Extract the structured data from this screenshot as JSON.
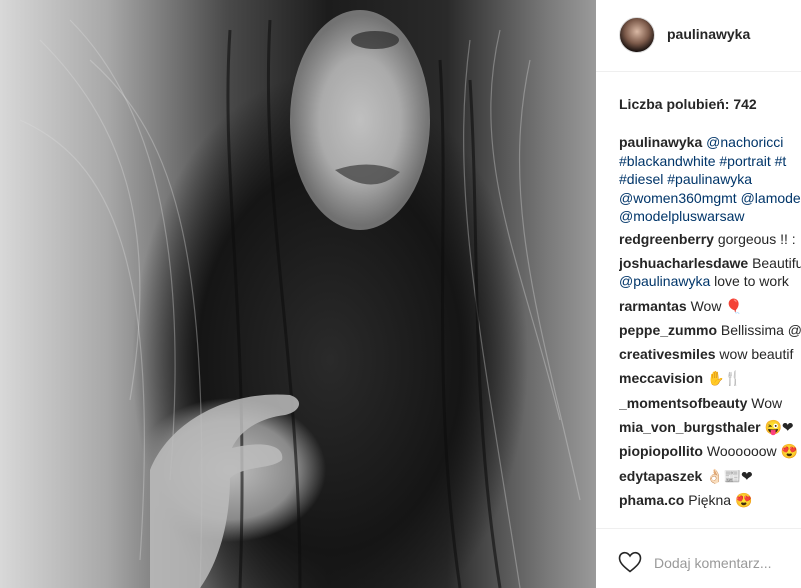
{
  "post": {
    "username": "paulinawyka",
    "likes_text": "Liczba polubień: 742",
    "caption": {
      "username": "paulinawyka",
      "lines": [
        "@nachoricci",
        "#blackandwhite #portrait #t",
        "#diesel #paulinawyka",
        "@women360mgmt @lamode",
        "@modelpluswarsaw"
      ]
    }
  },
  "comments": [
    {
      "user": "redgreenberry",
      "text": "gorgeous !! :"
    },
    {
      "user": "joshuacharlesdawe",
      "text": "Beautifu",
      "line2_mention": "@paulinawyka",
      "line2_text": " love to work"
    },
    {
      "user": "rarmantas",
      "text": "Wow 🎈"
    },
    {
      "user": "peppe_zummo",
      "text": "Bellissima @"
    },
    {
      "user": "creativesmiles",
      "text": "wow beautif"
    },
    {
      "user": "meccavision",
      "text": "✋🍴"
    },
    {
      "user": "_momentsofbeauty",
      "text": "Wow"
    },
    {
      "user": "mia_von_burgsthaler",
      "text": "😜❤"
    },
    {
      "user": "piopiopollito",
      "text": "Woooooow 😍"
    },
    {
      "user": "edytapaszek",
      "text": "👌🏻📰❤"
    },
    {
      "user": "phama.co",
      "text": "Piękna 😍"
    }
  ],
  "footer": {
    "add_comment_placeholder": "Dodaj komentarz...",
    "heart_icon": "heart-outline-icon"
  },
  "colors": {
    "link": "#003569",
    "text": "#262626",
    "muted": "#999999",
    "divider": "#efefef"
  }
}
